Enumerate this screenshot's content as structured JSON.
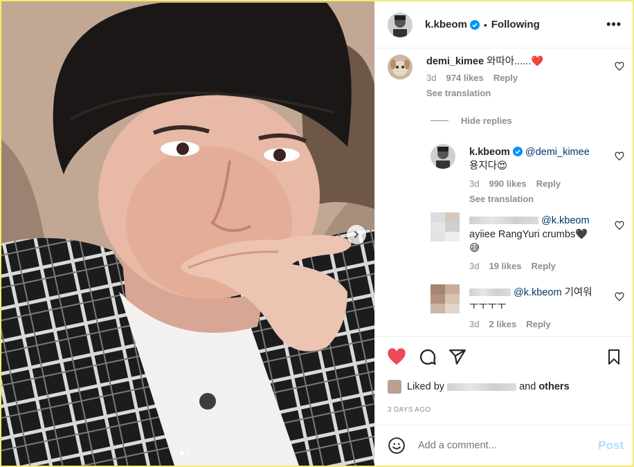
{
  "post": {
    "author": "k.kbeom",
    "following_label": "Following",
    "separator": "•",
    "more_label": "•••",
    "carousel": {
      "slides": 2,
      "current": 1
    }
  },
  "comments": [
    {
      "user": "demi_kimee",
      "text": "와따아......",
      "emoji": "❤️",
      "time": "3d",
      "likes": "974 likes",
      "reply": "Reply",
      "translation": "See translation"
    }
  ],
  "hide_replies": "Hide replies",
  "replies": [
    {
      "user": "k.kbeom",
      "mention": "@demi_kimee",
      "text": "용지다",
      "emoji": "😍",
      "time": "3d",
      "likes": "990 likes",
      "reply": "Reply",
      "translation": "See translation"
    },
    {
      "mention": "@k.kbeom",
      "text": "ayiiee RangYuri crumbs🖤",
      "emoji": "😅",
      "time": "3d",
      "likes": "19 likes",
      "reply": "Reply"
    },
    {
      "mention": "@k.kbeom",
      "text": "기여워",
      "text2": "ㅜㅜㅜㅜ",
      "time": "3d",
      "likes": "2 likes",
      "reply": "Reply"
    }
  ],
  "liked_by": {
    "prefix": "Liked by",
    "and": "and",
    "others": "others"
  },
  "date": "3 DAYS AGO",
  "add_comment": {
    "placeholder": "Add a comment...",
    "post": "Post"
  },
  "colors": {
    "like_red": "#ed4956",
    "link_blue": "#00376b",
    "verified_blue": "#0095f6",
    "post_disabled": "#b2dffc"
  },
  "icons": [
    "heart-icon",
    "comment-icon",
    "share-icon",
    "bookmark-icon",
    "emoji-icon",
    "verified-icon",
    "chevron-right-icon"
  ]
}
